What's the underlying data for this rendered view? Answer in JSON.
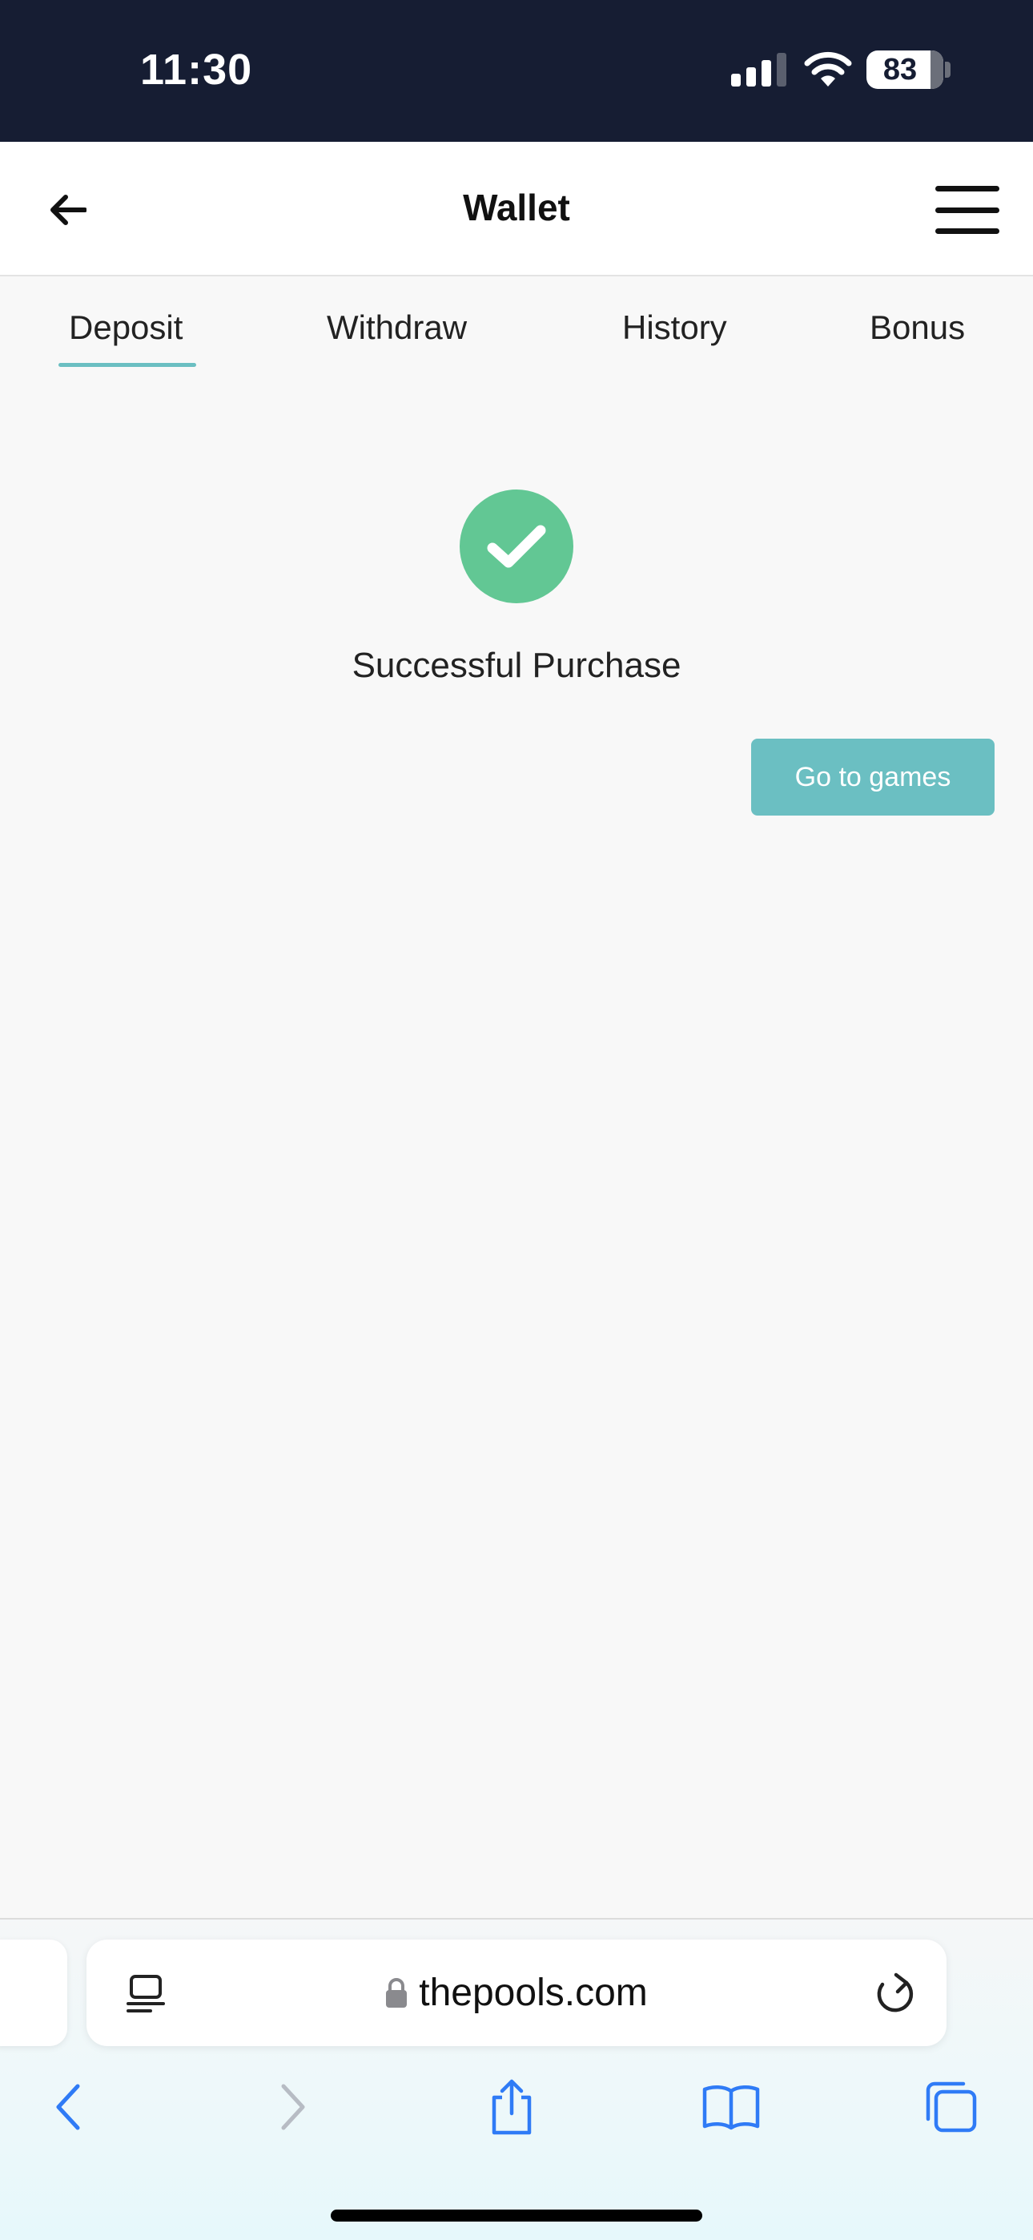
{
  "status_bar": {
    "time": "11:30",
    "battery_level": "83",
    "battery_fraction": 0.83
  },
  "header": {
    "title": "Wallet",
    "back_icon": "arrow-left-icon",
    "menu_icon": "hamburger-menu-icon"
  },
  "tabs": [
    {
      "label": "Deposit",
      "active": true
    },
    {
      "label": "Withdraw",
      "active": false
    },
    {
      "label": "History",
      "active": false
    },
    {
      "label": "Bonus",
      "active": false
    }
  ],
  "success": {
    "icon": "checkmark-circle-icon",
    "message": "Successful Purchase",
    "button_label": "Go to games"
  },
  "browser": {
    "url": "thepools.com",
    "toolbar_icons": [
      "back-icon",
      "forward-icon",
      "share-icon",
      "bookmarks-icon",
      "tabs-icon"
    ]
  },
  "colors": {
    "status_bar_bg": "#161d33",
    "accent_teal": "#6bbfc2",
    "success_green": "#62c794",
    "safari_blue": "#2f7bf6"
  }
}
